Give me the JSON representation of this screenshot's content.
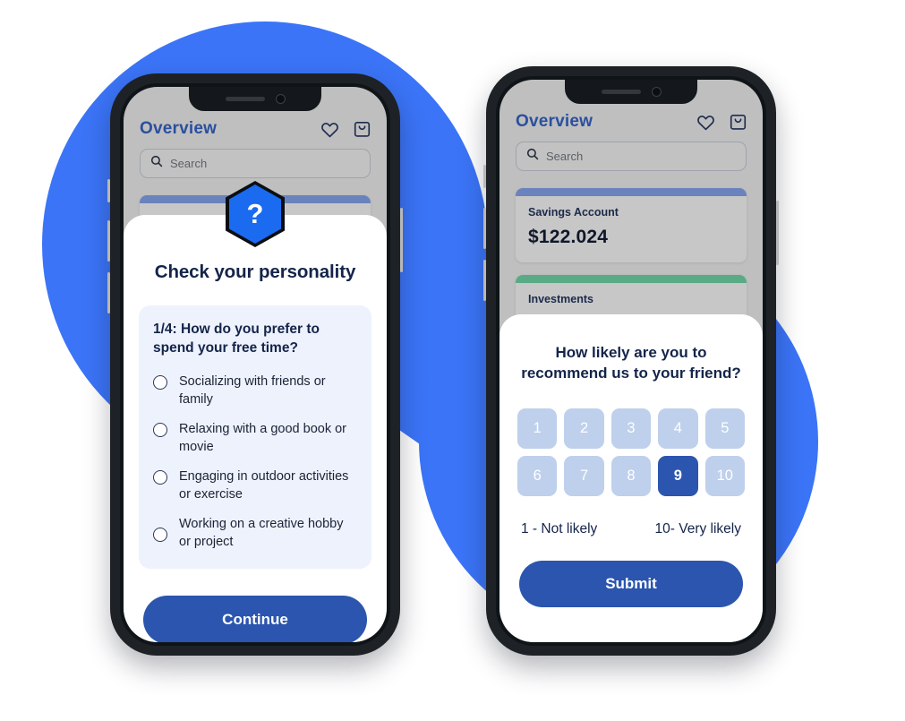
{
  "colors": {
    "brand_blue": "#3b74f7",
    "primary": "#2b55ae",
    "hex_blue": "#1a6bf0",
    "navy_text": "#14244a",
    "savings_strip": "#6b83bd",
    "investments_strip": "#5aab85",
    "nps_inactive": "#bed0ec"
  },
  "phone_left": {
    "app": {
      "title": "Overview",
      "icons": [
        {
          "name": "heart-icon",
          "glyph": "heart"
        },
        {
          "name": "shopping-bag-icon",
          "glyph": "bag"
        }
      ],
      "search": {
        "placeholder": "Search",
        "value": "",
        "icon": "search-icon"
      }
    },
    "modal": {
      "badge_icon": "question-mark-icon",
      "badge_glyph": "?",
      "title": "Check your personality",
      "question": "1/4: How do you prefer to spend your free time?",
      "options": [
        {
          "label": "Socializing with friends or family",
          "selected": false
        },
        {
          "label": "Relaxing with a good book or movie",
          "selected": false
        },
        {
          "label": "Engaging in outdoor activities or exercise",
          "selected": false
        },
        {
          "label": "Working on a creative hobby or project",
          "selected": false
        }
      ],
      "primary_button": "Continue"
    }
  },
  "phone_right": {
    "app": {
      "title": "Overview",
      "icons": [
        {
          "name": "heart-icon",
          "glyph": "heart"
        },
        {
          "name": "shopping-bag-icon",
          "glyph": "bag"
        }
      ],
      "search": {
        "placeholder": "Search",
        "value": "",
        "icon": "search-icon"
      },
      "cards": [
        {
          "name": "Savings Account",
          "amount": "$122.024",
          "strip": "#6b83bd"
        },
        {
          "name": "Investments",
          "amount": "",
          "strip": "#5aab85"
        }
      ]
    },
    "modal": {
      "title": "How likely are you to recommend us to your friend?",
      "scale": [
        "1",
        "2",
        "3",
        "4",
        "5",
        "6",
        "7",
        "8",
        "9",
        "10"
      ],
      "selected_value": "9",
      "legend_low": "1 - Not likely",
      "legend_high": "10- Very likely",
      "primary_button": "Submit"
    }
  }
}
